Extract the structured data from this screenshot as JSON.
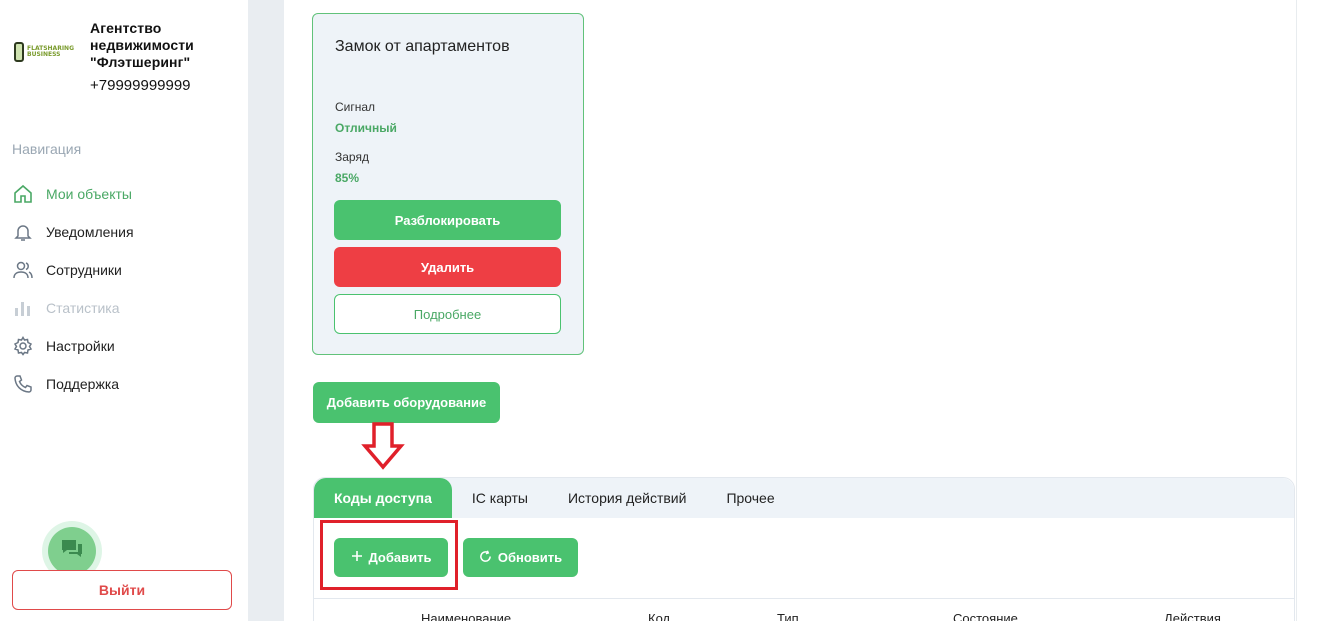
{
  "sidebar": {
    "logo": {
      "line1": "FLATSHARING",
      "line2": "BUSINESS"
    },
    "brand_name": "Агентство недвижимости \"Флэтшеринг\"",
    "phone": "+79999999999",
    "nav_title": "Навигация",
    "items": [
      {
        "label": "Мои объекты",
        "icon": "home-icon",
        "state": "active"
      },
      {
        "label": "Уведомления",
        "icon": "bell-icon",
        "state": "normal"
      },
      {
        "label": "Сотрудники",
        "icon": "users-icon",
        "state": "normal"
      },
      {
        "label": "Статистика",
        "icon": "bar-chart-icon",
        "state": "disabled"
      },
      {
        "label": "Настройки",
        "icon": "gear-icon",
        "state": "normal"
      },
      {
        "label": "Поддержка",
        "icon": "phone-icon",
        "state": "normal"
      }
    ],
    "logout_label": "Выйти"
  },
  "device": {
    "title": "Замок от апартаментов",
    "signal_label": "Сигнал",
    "signal_value": "Отличный",
    "charge_label": "Заряд",
    "charge_value": "85%",
    "unlock_label": "Разблокировать",
    "delete_label": "Удалить",
    "details_label": "Подробнее"
  },
  "add_equipment_label": "Добавить оборудование",
  "tabs": [
    {
      "label": "Коды доступа",
      "active": true
    },
    {
      "label": "IC карты",
      "active": false
    },
    {
      "label": "История действий",
      "active": false
    },
    {
      "label": "Прочее",
      "active": false
    }
  ],
  "actions": {
    "add_label": "Добавить",
    "refresh_label": "Обновить"
  },
  "table": {
    "headers": [
      "Наименование",
      "Код",
      "Тип",
      "Состояние",
      "Действия"
    ]
  },
  "colors": {
    "accent": "#4ac26f",
    "danger": "#ee3e44",
    "annotation": "#e0202a"
  }
}
